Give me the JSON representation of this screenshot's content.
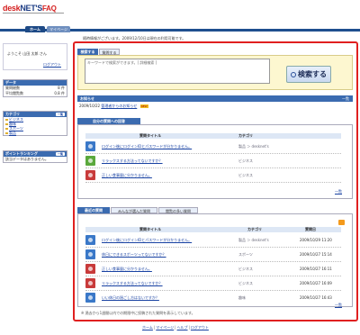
{
  "logo": {
    "part1": "desk",
    "part2": "NET'S",
    "part3": "FAQ"
  },
  "tabs": {
    "home": "ホーム",
    "mypage": "マイページ"
  },
  "welcome": "随時情報がございます。2009/12/10日は現在の利用可能です。",
  "user": {
    "name": "ようこそ 山田 太郎 さん",
    "logout": "ログアウト"
  },
  "data_box": {
    "title": "データ",
    "rows": [
      {
        "label": "質問総数",
        "value": "8 件"
      },
      {
        "label": "平均閲覧数",
        "value": "0.8 件"
      }
    ]
  },
  "category_box": {
    "title": "カテゴリ",
    "more": "一覧",
    "items": [
      "ビジネス",
      "趣味",
      "スポーツ",
      "製品"
    ]
  },
  "ranking_box": {
    "title": "ポイントランキング",
    "more": "一覧",
    "empty": "該当データはありません。"
  },
  "search": {
    "tab_active": "検索する",
    "tab_other": "質問する",
    "placeholder": "キーワードで検索ができます。[ 詳細検索 ]",
    "button": "検索する"
  },
  "notice": {
    "title": "お知らせ",
    "more": "一覧",
    "date": "2009/10/22",
    "link": "管理者からのお知らせ",
    "badge": "NEW"
  },
  "my_questions": {
    "tab": "自分の質問への回答",
    "col_title": "質問タイトル",
    "col_category": "カテゴリ",
    "rows": [
      {
        "title": "ログイン後にログインIDとパスワードが分かりません。",
        "category": "製品 ＞ desknet's"
      },
      {
        "title": "リラックスする方法ってないですか？",
        "category": "ビジネス"
      },
      {
        "title": "正しい食事量に分かりません。",
        "category": "ビジネス"
      }
    ],
    "more": "一覧"
  },
  "recent": {
    "tabs": [
      "最近の質問",
      "みんなが選んだ質問",
      "閲覧の多い質問"
    ],
    "col_title": "質問タイトル",
    "col_category": "カテゴリ",
    "col_date": "質問日",
    "rows": [
      {
        "title": "ログイン後にログインIDとパスワードが分かりません。",
        "category": "製品 ＞ desknet's",
        "date": "2009/10/29 11:20"
      },
      {
        "title": "休日にできるスポーツってないですか？",
        "category": "スポーツ",
        "date": "2009/10/27 15:14"
      },
      {
        "title": "正しい食事量に分かりません。",
        "category": "ビジネス",
        "date": "2009/10/27 16:11"
      },
      {
        "title": "リラックスする方法ってないですか？",
        "category": "ビジネス",
        "date": "2009/10/27 16:09"
      },
      {
        "title": "いい休日の過ごし方はないですか？",
        "category": "趣味",
        "date": "2009/10/27 16:43"
      }
    ],
    "more": "一覧"
  },
  "footnote": "※ 過去から1週間以内での期限中に投稿された質問を表示しています。",
  "footer": {
    "home": "ホーム",
    "mypage": "マイページ",
    "help": "ヘルプ",
    "logout": "ログアウト"
  },
  "colors": {
    "accent": "#3b6bb0",
    "frame": "#e02020"
  }
}
